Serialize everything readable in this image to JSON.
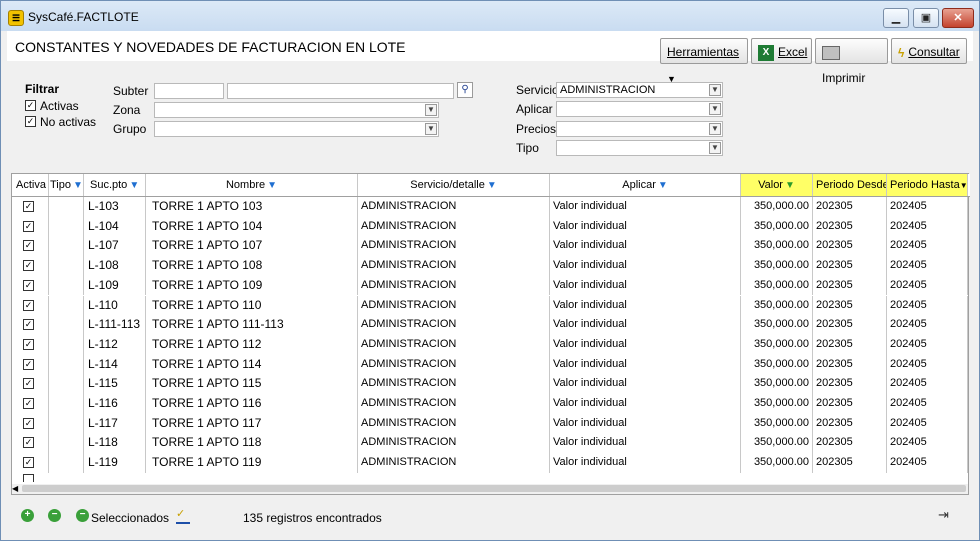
{
  "window": {
    "title": "SysCafé.FACTLOTE",
    "page_title": "CONSTANTES Y NOVEDADES DE FACTURACION EN LOTE"
  },
  "toolbar": {
    "herramientas": "Herramientas",
    "excel": "Excel",
    "imprimir": "Imprimir",
    "consultar": "Consultar"
  },
  "filters": {
    "filtrar_label": "Filtrar",
    "activas_label": "Activas",
    "no_activas_label": "No activas",
    "subter_label": "Subter",
    "zona_label": "Zona",
    "grupo_label": "Grupo",
    "servicio_label": "Servicio",
    "servicio_value": "ADMINISTRACION",
    "aplicar_label": "Aplicar",
    "precios_label": "Precios",
    "tipo_label": "Tipo"
  },
  "table": {
    "columns": [
      "Activa",
      "Tipo",
      "Suc.pto",
      "Nombre",
      "Servicio/detalle",
      "Aplicar",
      "Valor",
      "Periodo Desde",
      "Periodo Hasta"
    ],
    "rows": [
      {
        "suc": "L-103",
        "nombre": "TORRE 1 APTO 103",
        "servicio": "ADMINISTRACION",
        "aplicar": "Valor individual",
        "valor": "350,000.00",
        "desde": "202305",
        "hasta": "202405"
      },
      {
        "suc": "L-104",
        "nombre": "TORRE 1 APTO 104",
        "servicio": "ADMINISTRACION",
        "aplicar": "Valor individual",
        "valor": "350,000.00",
        "desde": "202305",
        "hasta": "202405"
      },
      {
        "suc": "L-107",
        "nombre": "TORRE 1 APTO 107",
        "servicio": "ADMINISTRACION",
        "aplicar": "Valor individual",
        "valor": "350,000.00",
        "desde": "202305",
        "hasta": "202405"
      },
      {
        "suc": "L-108",
        "nombre": "TORRE 1 APTO 108",
        "servicio": "ADMINISTRACION",
        "aplicar": "Valor individual",
        "valor": "350,000.00",
        "desde": "202305",
        "hasta": "202405"
      },
      {
        "suc": "L-109",
        "nombre": "TORRE 1 APTO 109",
        "servicio": "ADMINISTRACION",
        "aplicar": "Valor individual",
        "valor": "350,000.00",
        "desde": "202305",
        "hasta": "202405"
      },
      {
        "suc": "L-110",
        "nombre": "TORRE 1 APTO 110",
        "servicio": "ADMINISTRACION",
        "aplicar": "Valor individual",
        "valor": "350,000.00",
        "desde": "202305",
        "hasta": "202405"
      },
      {
        "suc": "L-111-113",
        "nombre": "TORRE 1 APTO 111-113",
        "servicio": "ADMINISTRACION",
        "aplicar": "Valor individual",
        "valor": "350,000.00",
        "desde": "202305",
        "hasta": "202405"
      },
      {
        "suc": "L-112",
        "nombre": "TORRE 1 APTO 112",
        "servicio": "ADMINISTRACION",
        "aplicar": "Valor individual",
        "valor": "350,000.00",
        "desde": "202305",
        "hasta": "202405"
      },
      {
        "suc": "L-114",
        "nombre": "TORRE 1 APTO 114",
        "servicio": "ADMINISTRACION",
        "aplicar": "Valor individual",
        "valor": "350,000.00",
        "desde": "202305",
        "hasta": "202405"
      },
      {
        "suc": "L-115",
        "nombre": "TORRE 1 APTO 115",
        "servicio": "ADMINISTRACION",
        "aplicar": "Valor individual",
        "valor": "350,000.00",
        "desde": "202305",
        "hasta": "202405"
      },
      {
        "suc": "L-116",
        "nombre": "TORRE 1 APTO 116",
        "servicio": "ADMINISTRACION",
        "aplicar": "Valor individual",
        "valor": "350,000.00",
        "desde": "202305",
        "hasta": "202405"
      },
      {
        "suc": "L-117",
        "nombre": "TORRE 1 APTO 117",
        "servicio": "ADMINISTRACION",
        "aplicar": "Valor individual",
        "valor": "350,000.00",
        "desde": "202305",
        "hasta": "202405"
      },
      {
        "suc": "L-118",
        "nombre": "TORRE 1 APTO 118",
        "servicio": "ADMINISTRACION",
        "aplicar": "Valor individual",
        "valor": "350,000.00",
        "desde": "202305",
        "hasta": "202405"
      },
      {
        "suc": "L-119",
        "nombre": "TORRE 1 APTO 119",
        "servicio": "ADMINISTRACION",
        "aplicar": "Valor individual",
        "valor": "350,000.00",
        "desde": "202305",
        "hasta": "202405"
      }
    ]
  },
  "footer": {
    "seleccionados": "Seleccionados",
    "count_text": "135 registros encontrados"
  },
  "colors": {
    "highlight_header": "#ffff66",
    "title_bar": "#c9dcf1"
  }
}
